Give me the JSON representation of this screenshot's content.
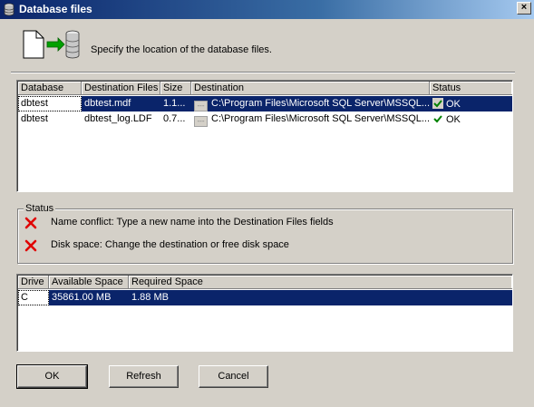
{
  "window": {
    "title": "Database files",
    "close_glyph": "×"
  },
  "header": {
    "description": "Specify the location of the database files.",
    "icon": "file-to-database-icon"
  },
  "files_table": {
    "columns": [
      "Database",
      "Destination Files",
      "Size",
      "Destination",
      "Status"
    ],
    "rows": [
      {
        "database": "dbtest",
        "destination_file": "dbtest.mdf",
        "size": "1.1...",
        "destination": "C:\\Program Files\\Microsoft SQL Server\\MSSQL...",
        "status": "OK",
        "selected": true
      },
      {
        "database": "dbtest",
        "destination_file": "dbtest_log.LDF",
        "size": "0.7...",
        "destination": "C:\\Program Files\\Microsoft SQL Server\\MSSQL...",
        "status": "OK",
        "selected": false
      }
    ],
    "browse_glyph": "---"
  },
  "status_group": {
    "label": "Status",
    "items": [
      {
        "icon": "red-x-icon",
        "message": "Name conflict: Type a new name into the Destination Files fields"
      },
      {
        "icon": "red-x-icon",
        "message": "Disk space: Change the destination or free disk space"
      }
    ]
  },
  "drive_table": {
    "columns": [
      "Drive",
      "Available Space",
      "Required Space"
    ],
    "rows": [
      {
        "drive": "C",
        "available": "35861.00  MB",
        "required": "1.88  MB",
        "selected": true
      }
    ]
  },
  "buttons": {
    "ok": "OK",
    "refresh": "Refresh",
    "cancel": "Cancel"
  },
  "colors": {
    "selection": "#0a246a",
    "dialog_bg": "#d4d0c8",
    "error_red": "#e00000",
    "ok_green": "#008000"
  }
}
